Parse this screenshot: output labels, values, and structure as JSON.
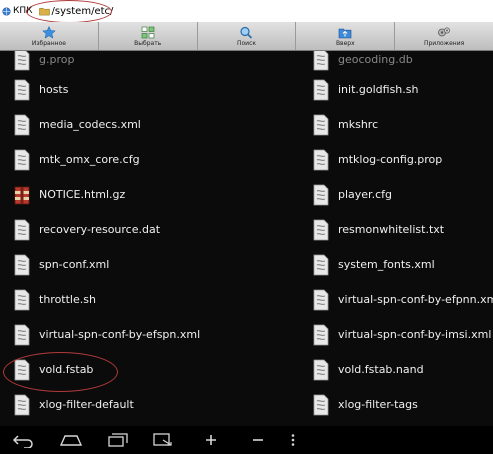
{
  "address_bar": {
    "app_label": "КПК",
    "path": "/system/etc/"
  },
  "toolbar": {
    "buttons": [
      {
        "label": "Избранное",
        "icon": "star-icon"
      },
      {
        "label": "Выбрать",
        "icon": "select-grid-icon"
      },
      {
        "label": "Поиск",
        "icon": "search-icon"
      },
      {
        "label": "Вверх",
        "icon": "folder-up-icon"
      },
      {
        "label": "Приложения",
        "icon": "apps-gear-icon"
      }
    ]
  },
  "files": {
    "partial_row": [
      "g.prop",
      "geocoding.db"
    ],
    "rows": [
      [
        "hosts",
        "init.goldfish.sh"
      ],
      [
        "media_codecs.xml",
        "mkshrc"
      ],
      [
        "mtk_omx_core.cfg",
        "mtklog-config.prop"
      ],
      [
        "NOTICE.html.gz",
        "player.cfg"
      ],
      [
        "recovery-resource.dat",
        "resmonwhitelist.txt"
      ],
      [
        "spn-conf.xml",
        "system_fonts.xml"
      ],
      [
        "throttle.sh",
        "virtual-spn-conf-by-efpnn.xml"
      ],
      [
        "virtual-spn-conf-by-efspn.xml",
        "virtual-spn-conf-by-imsi.xml"
      ],
      [
        "vold.fstab",
        "vold.fstab.nand"
      ],
      [
        "xlog-filter-default",
        "xlog-filter-tags"
      ]
    ],
    "archive_file": "NOTICE.html.gz"
  },
  "navbar": {
    "icons": [
      "back-icon",
      "home-icon",
      "recent-apps-icon",
      "screenshot-icon",
      "volume-up-icon",
      "volume-down-icon",
      "menu-icon"
    ]
  }
}
